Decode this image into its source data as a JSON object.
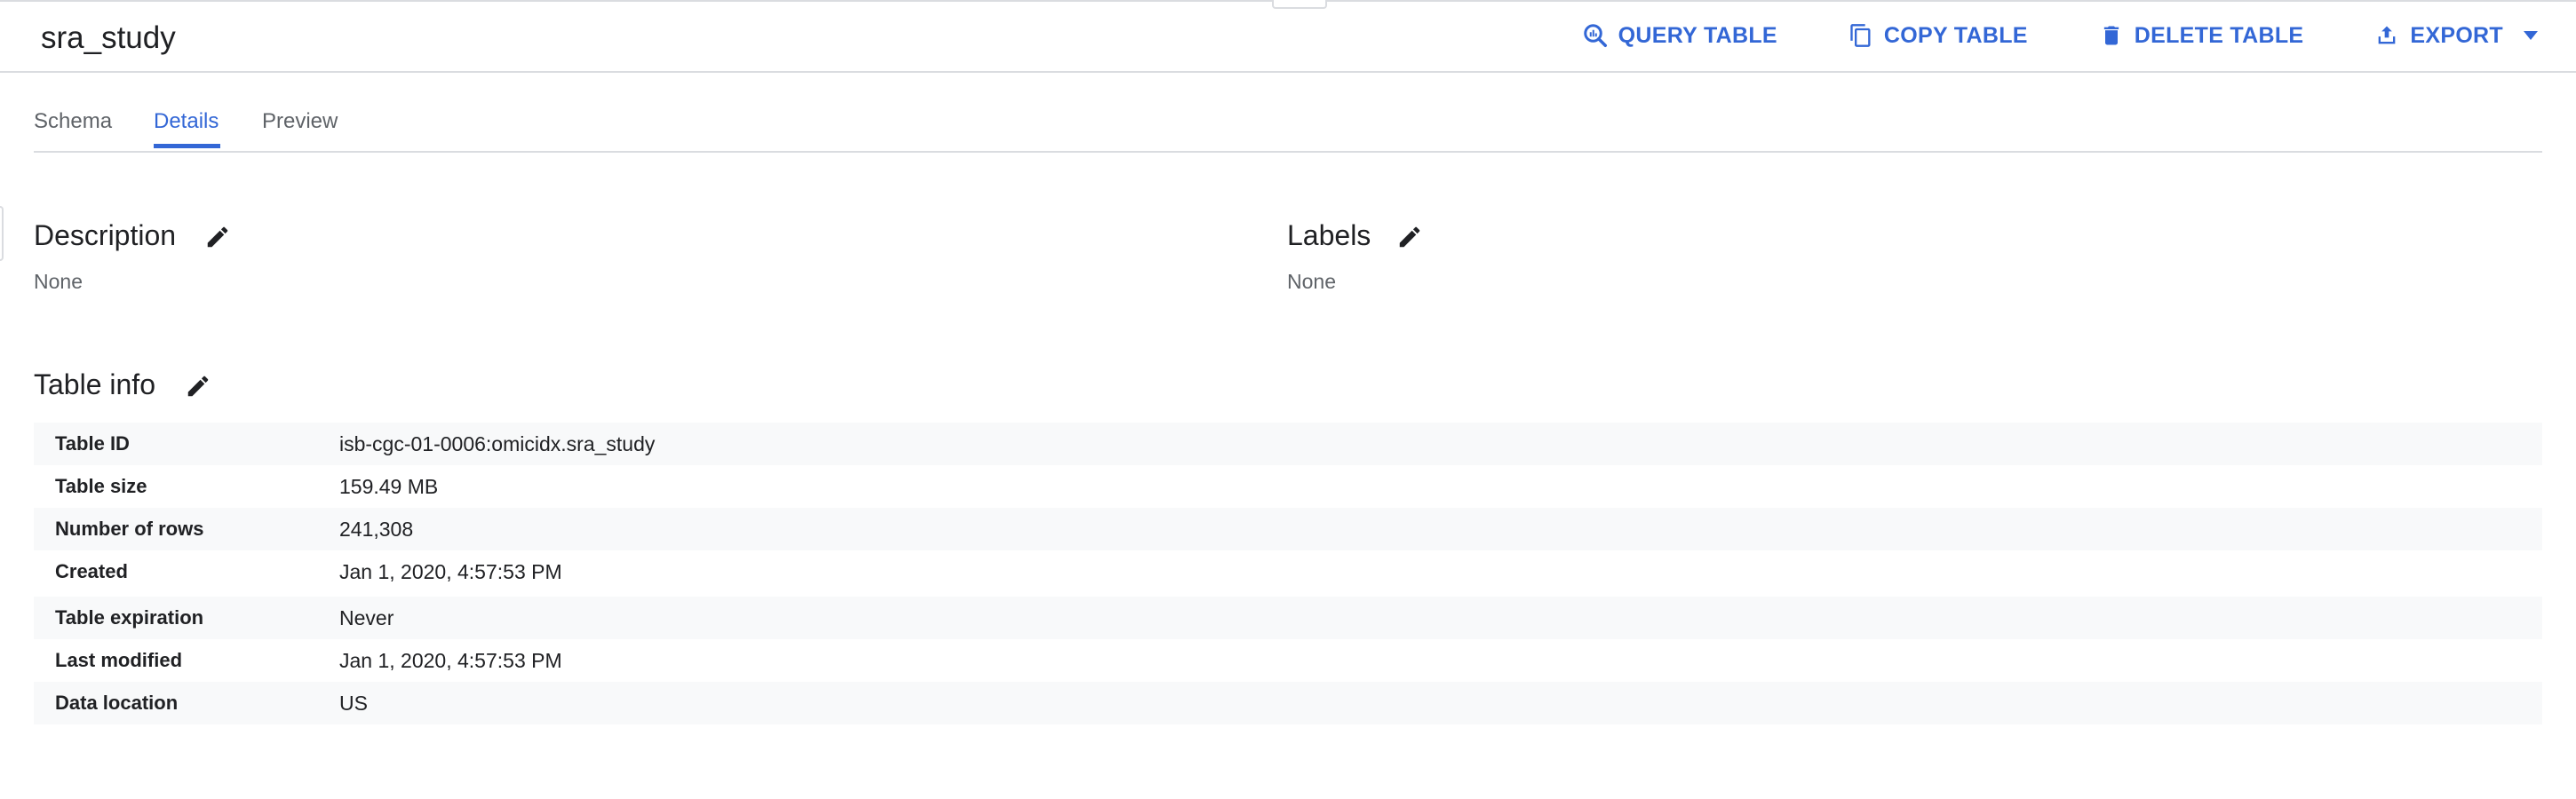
{
  "header": {
    "title": "sra_study",
    "actions": [
      {
        "label": "QUERY TABLE",
        "icon": "query-icon"
      },
      {
        "label": "COPY TABLE",
        "icon": "copy-icon"
      },
      {
        "label": "DELETE TABLE",
        "icon": "trash-icon"
      },
      {
        "label": "EXPORT",
        "icon": "upload-icon"
      }
    ],
    "accent_color": "#3367d6"
  },
  "tabs": [
    {
      "label": "Schema",
      "active": false
    },
    {
      "label": "Details",
      "active": true
    },
    {
      "label": "Preview",
      "active": false
    }
  ],
  "description": {
    "title": "Description",
    "value": "None"
  },
  "labels": {
    "title": "Labels",
    "value": "None"
  },
  "table_info": {
    "title": "Table info",
    "rows": [
      {
        "key": "Table ID",
        "value": "isb-cgc-01-0006:omicidx.sra_study"
      },
      {
        "key": "Table size",
        "value": "159.49 MB"
      },
      {
        "key": "Number of rows",
        "value": "241,308"
      },
      {
        "key": "Created",
        "value": "Jan 1, 2020, 4:57:53 PM"
      },
      {
        "key": "Table expiration",
        "value": "Never"
      },
      {
        "key": "Last modified",
        "value": "Jan 1, 2020, 4:57:53 PM"
      },
      {
        "key": "Data location",
        "value": "US"
      }
    ]
  }
}
